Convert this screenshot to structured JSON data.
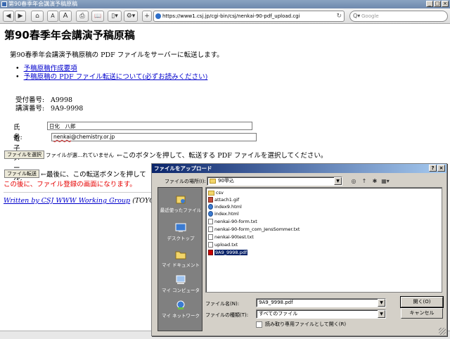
{
  "window": {
    "title": "第90春季年会講演予稿原稿",
    "controls": [
      "_",
      "□",
      "×"
    ]
  },
  "toolbar": {
    "back": "◀",
    "forward": "▶",
    "home": "⌂",
    "font_small": "A",
    "font_large": "A",
    "print": "⎙",
    "bookmarks": "📖",
    "page_menu": "▯▾",
    "settings": "⚙▾",
    "add": "+",
    "url": "https://www1.csj.jp/cgi-bin/csj/nenkai-90-pdf_upload.cgi",
    "reload": "↻",
    "search_placeholder": "Google",
    "search_icon": "Q▾"
  },
  "page": {
    "title": "第90春季年会講演予稿原稿",
    "intro": "第90春季年会講演予稿原稿の PDF ファイルをサーバーに転送します。",
    "links": [
      "予稿原稿作成要項",
      "予稿原稿の PDF ファイル転送について(必ずお読みください)"
    ],
    "info": [
      {
        "label": "受付番号:",
        "value": "A9998"
      },
      {
        "label": "講演番号:",
        "value": "9A9-9998"
      }
    ],
    "name_label": "氏名:",
    "name_value": "日化　八郎",
    "email_label": "電子メール:",
    "email_value_prefix": "nenkai",
    "email_value_rest": "@chemistry.or.jp",
    "file_button": "ファイルを選択",
    "file_status": "ファイルが選…れていません",
    "file_instruction": "←このボタンを押して、転送する PDF ファイルを選択してください。",
    "transfer_button": "ファイル転送",
    "transfer_instruction": "←最後に、この転送ボタンを押して",
    "warning": "この後に、ファイル登録の画面になります。",
    "footer_link": "Written by CSJ WWW Working Group",
    "footer_rest": "(TOYODA, ..."
  },
  "dialog": {
    "title": "ファイルをアップロード",
    "title_buttons": [
      "?",
      "×"
    ],
    "location_label": "ファイルの場所(I):",
    "location_value": "90甲込",
    "toolbar_icons": [
      "◎",
      "↑",
      "✱",
      "▦▾"
    ],
    "places": [
      "最近使ったファイル",
      "デスクトップ",
      "マイ ドキュメント",
      "マイ コンピュータ",
      "マイ ネットワーク"
    ],
    "files": [
      {
        "name": "csv",
        "type": "folder"
      },
      {
        "name": "attach1.gif",
        "type": "gif"
      },
      {
        "name": "index9.html",
        "type": "html"
      },
      {
        "name": "index.html",
        "type": "html"
      },
      {
        "name": "nenkai-90-form.txt",
        "type": "txt"
      },
      {
        "name": "nenkai-90-form_com_JensSommer.txt",
        "type": "txt"
      },
      {
        "name": "nenkai-90test.txt",
        "type": "txt"
      },
      {
        "name": "upload.txt",
        "type": "txt"
      },
      {
        "name": "9A9_9998.pdf",
        "type": "pdf",
        "selected": true
      }
    ],
    "filename_label": "ファイル名(N):",
    "filename_value": "9A9_9998.pdf",
    "filetype_label": "ファイルの種類(T):",
    "filetype_value": "すべてのファイル",
    "readonly_label": "読み取り専用ファイルとして開く(R)",
    "open_button": "開く(O)",
    "cancel_button": "キャンセル"
  }
}
